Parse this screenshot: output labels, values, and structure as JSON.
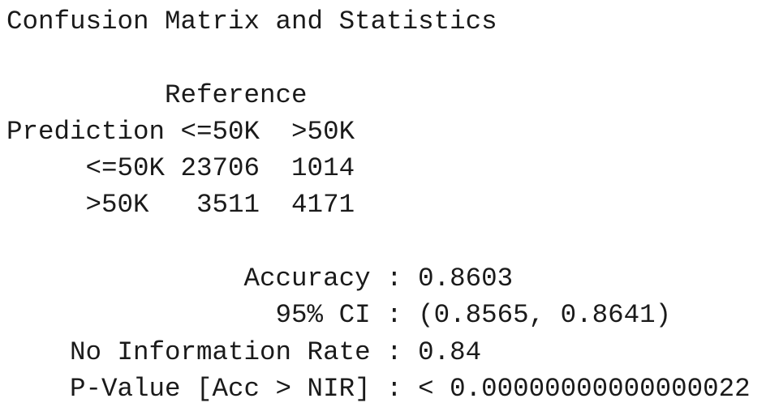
{
  "output": {
    "title": "Confusion Matrix and Statistics",
    "blank_1": "",
    "reference_header": "          Reference",
    "prediction_header": "Prediction <=50K  >50K",
    "row_le50k": "     <=50K 23706  1014",
    "row_gt50k": "     >50K   3511  4171",
    "blank_2": "",
    "accuracy": "               Accuracy : 0.8603",
    "ci": "                 95% CI : (0.8565, 0.8641)",
    "nir": "    No Information Rate : 0.84",
    "pvalue": "    P-Value [Acc > NIR] : < 0.00000000000000022"
  }
}
